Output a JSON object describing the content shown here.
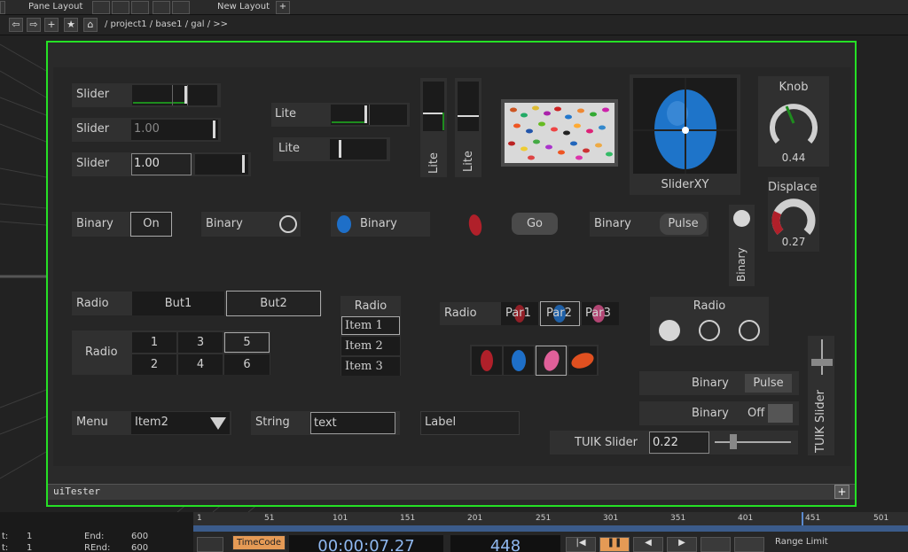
{
  "topbar": {
    "pane_layout": "Pane Layout",
    "new_layout": "New Layout",
    "plus": "+"
  },
  "pathbar": {
    "path": "/ project1 / base1 / gal / >>"
  },
  "footer": {
    "name": "uiTester",
    "plus": "+"
  },
  "widgets": {
    "slider1": "Slider",
    "slider2": "Slider",
    "slider2_val": "1.00",
    "slider3": "Slider",
    "slider3_val": "1.00",
    "lite1": "Lite",
    "lite2": "Lite",
    "lite3": "Lite",
    "lite4": "Lite",
    "sliderxy": "SliderXY",
    "knob": "Knob",
    "knob_val": "0.44",
    "displace": "Displace",
    "displace_val": "0.27",
    "binary_on_label": "Binary",
    "binary_on_btn": "On",
    "binary_circle": "Binary",
    "binary_jelly": "Binary",
    "go": "Go",
    "binary_pulse": "Binary",
    "pulse": "Pulse",
    "binary_vert": "Binary",
    "radio1": "Radio",
    "but1": "But1",
    "but2": "But2",
    "radio_list_title": "Radio",
    "items": [
      "Item 1",
      "Item 2",
      "Item 3"
    ],
    "radio_par": "Radio",
    "pars": [
      "Par1",
      "Par2",
      "Par3"
    ],
    "radio_circles": "Radio",
    "radio_grid": "Radio",
    "grid": [
      "1",
      "3",
      "5",
      "2",
      "4",
      "6"
    ],
    "binary_pulse2": "Binary",
    "pulse2": "Pulse",
    "binary_off": "Binary",
    "off": "Off",
    "tuik": "TUIK Slider",
    "tuik_val": "0.22",
    "tuik_vert": "TUIK Slider",
    "menu": "Menu",
    "menu_val": "Item2",
    "string": "String",
    "string_val": "text",
    "label": "Label"
  },
  "timeline": {
    "ticks": [
      "1",
      "51",
      "101",
      "151",
      "201",
      "251",
      "301",
      "351",
      "401",
      "451",
      "501"
    ]
  },
  "bottom": {
    "start_lbl": "t:",
    "start_val": "1",
    "end_lbl": "End:",
    "end_val": "600",
    "rstart_lbl": "t:",
    "rstart_val": "1",
    "rend_lbl": "REnd:",
    "rend_val": "600",
    "timecode": "TimeCode",
    "time": "00:00:07.27",
    "frame": "448",
    "range_limit": "Range Limit"
  },
  "colors": {
    "accent_green": "#25e025",
    "blue": "#1e6fc8",
    "red": "#b0202a"
  }
}
